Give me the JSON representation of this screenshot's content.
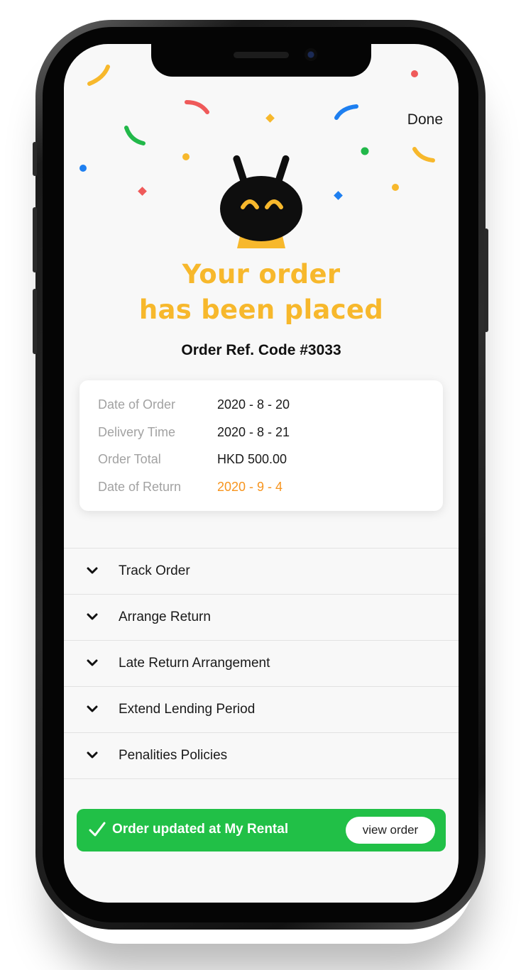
{
  "header": {
    "done_label": "Done"
  },
  "headline": {
    "line1": "Your order",
    "line2": "has been placed"
  },
  "order_ref": "Order Ref. Code #3033",
  "details": [
    {
      "label": "Date of Order",
      "value": "2020 - 8 - 20"
    },
    {
      "label": "Delivery Time",
      "value": "2020 - 8 - 21"
    },
    {
      "label": "Order Total",
      "value": "HKD 500.00"
    },
    {
      "label": "Date of Return",
      "value": "2020 - 9 - 4"
    }
  ],
  "accordion": [
    {
      "label": "Track Order"
    },
    {
      "label": "Arrange Return"
    },
    {
      "label": "Late Return Arrangement"
    },
    {
      "label": "Extend Lending Period"
    },
    {
      "label": "Penalities Policies"
    }
  ],
  "banner": {
    "message": "Order updated at My Rental",
    "button_label": "view order"
  },
  "icons": {
    "chevron": "chevron-down-icon",
    "check": "check-icon",
    "mascot": "mascot-icon"
  },
  "colors": {
    "accent_yellow": "#f7b82c",
    "return_orange": "#f7941d",
    "success_green": "#21c047",
    "screen_bg": "#f8f8f8"
  }
}
